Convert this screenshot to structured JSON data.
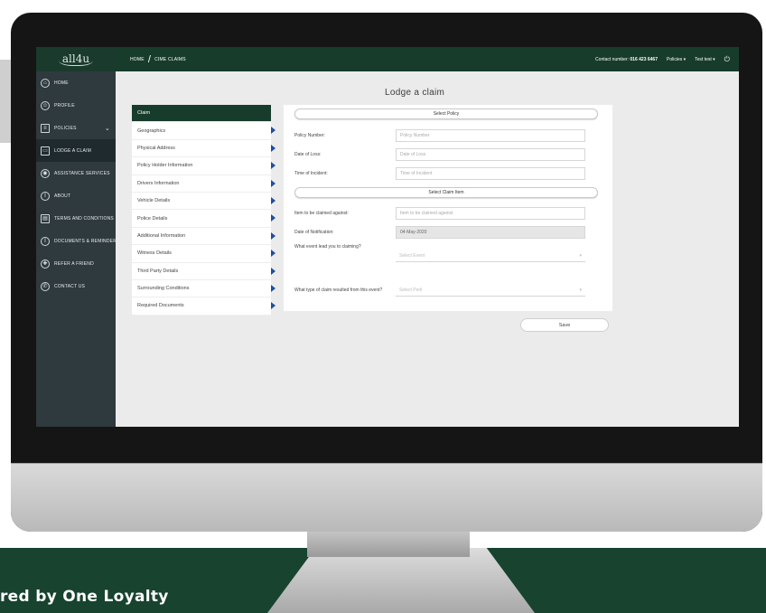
{
  "app": {
    "logo_text": "all4u",
    "breadcrumb": [
      "HOME",
      "/",
      "CIME CLAIMS"
    ],
    "contact_label": "Contact number:",
    "contact_number": "016 423 6467",
    "policies_menu": "Policies",
    "user_menu": "Test test",
    "caret": "▾",
    "power": "⏻"
  },
  "sidebar": {
    "items": [
      {
        "label": "HOME",
        "icon": "⌂",
        "icon_name": "home-icon"
      },
      {
        "label": "PROFILE",
        "icon": "☺",
        "icon_name": "profile-icon"
      },
      {
        "label": "POLICIES",
        "icon": "≡",
        "icon_name": "policies-icon",
        "chevron": "⌄"
      },
      {
        "label": "LODGE A CLAIM",
        "icon": "▭",
        "icon_name": "claim-icon"
      },
      {
        "label": "ASSISTANCE SERVICES",
        "icon": "◉",
        "icon_name": "location-icon"
      },
      {
        "label": "ABOUT",
        "icon": "i",
        "icon_name": "info-icon"
      },
      {
        "label": "TERMS AND CONDITIONS",
        "icon": "▤",
        "icon_name": "document-icon"
      },
      {
        "label": "DOCUMENTS & REMINDERS",
        "icon": "i",
        "icon_name": "reminders-icon"
      },
      {
        "label": "REFER A FRIEND",
        "icon": "✚",
        "icon_name": "refer-icon"
      },
      {
        "label": "CONTACT US",
        "icon": "✆",
        "icon_name": "phone-icon"
      }
    ]
  },
  "main": {
    "title": "Lodge a claim",
    "steps": [
      "Claim",
      "Geographics",
      "Physical Address",
      "Policy Holder Information",
      "Drivers Information",
      "Vehicle Details",
      "Police Details",
      "Additional Information",
      "Witness Details",
      "Third Party Details",
      "Surrounding Conditions",
      "Required Documents"
    ],
    "form": {
      "select_policy": "Select Policy",
      "policy_number_label": "Policy Number:",
      "policy_number_placeholder": "Policy Number",
      "date_loss_label": "Date of Loss:",
      "date_loss_placeholder": "Date of Loss",
      "time_incident_label": "Time of Incident:",
      "time_incident_placeholder": "Time of Incident",
      "select_claim_item": "Select Claim Item",
      "item_label": "Item to be claimed against:",
      "item_placeholder": "Item to be claimed against",
      "notification_label": "Date of Notification:",
      "notification_value": "04-May-2020",
      "event_label": "What event lead you to claiming?",
      "event_placeholder": "Select Event",
      "claim_type_label": "What type of claim resulted from this event?",
      "claim_type_placeholder": "Select Peril"
    },
    "save_label": "Save"
  },
  "footer": {
    "text": "red by One Loyalty"
  }
}
